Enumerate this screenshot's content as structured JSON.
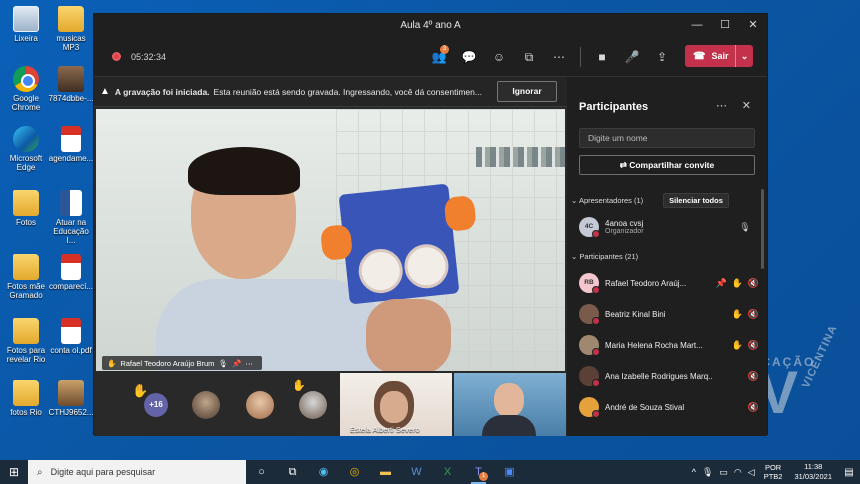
{
  "desktop": {
    "icons": [
      {
        "label": "Lixeira",
        "kind": "trash"
      },
      {
        "label": "musicas MP3",
        "kind": "folder"
      },
      {
        "label": "Google Chrome",
        "kind": "chrome"
      },
      {
        "label": "7874dbbe-...",
        "kind": "photo"
      },
      {
        "label": "Microsoft Edge",
        "kind": "edge"
      },
      {
        "label": "agendame...",
        "kind": "pdf"
      },
      {
        "label": "Fotos",
        "kind": "folder"
      },
      {
        "label": "Atuar na Educação I...",
        "kind": "word"
      },
      {
        "label": "Fotos mãe Gramado",
        "kind": "folder"
      },
      {
        "label": "comparecí...",
        "kind": "pdf"
      },
      {
        "label": "Fotos para revelar Rio",
        "kind": "folder"
      },
      {
        "label": "conta ol.pdf",
        "kind": "pdf"
      },
      {
        "label": "fotos Rio",
        "kind": "folder"
      },
      {
        "label": "CTHJ9652...",
        "kind": "photo2"
      }
    ]
  },
  "window": {
    "title": "Aula 4º ano A",
    "controls": {
      "minimize": "—",
      "maximize": "☐",
      "close": "✕"
    }
  },
  "toolbar": {
    "timer": "05:32:34",
    "participants_badge": "3",
    "leave_label": "Sair",
    "icons": [
      "people-icon",
      "chat-icon",
      "reactions-icon",
      "rooms-icon",
      "more-icon",
      "camera-icon",
      "mic-icon",
      "share-icon"
    ]
  },
  "banner": {
    "bold": "A gravação foi iniciada.",
    "text": "Esta reunião está sendo gravada. Ingressando, você dá consentimen...",
    "button": "Ignorar"
  },
  "main_video": {
    "name": "Rafael Teodoro Araújo Brum"
  },
  "strip": {
    "more_count": "+16",
    "thumbs": [
      {
        "name": "Estela Alberti Severo"
      }
    ]
  },
  "panel": {
    "title": "Participantes",
    "search_placeholder": "Digite um nome",
    "share_label": "Compartilhar convite",
    "presenters_label": "Apresentadores (1)",
    "mute_all": "Silenciar todos",
    "presenter": {
      "initials": "4C",
      "name": "4anoa cvsj",
      "role": "Organizador"
    },
    "participants_label": "Participantes (21)",
    "participants": [
      {
        "initials": "RB",
        "name": "Rafael Teodoro Araúj...",
        "hand": true,
        "pin": true,
        "color": "#f4c7cf"
      },
      {
        "initials": "",
        "name": "Beatriz Kinal Bini",
        "hand": true,
        "pin": false,
        "color": "#7a5a4a"
      },
      {
        "initials": "",
        "name": "Maria Helena Rocha Mart...",
        "hand": true,
        "pin": false,
        "color": "#a08870"
      },
      {
        "initials": "",
        "name": "Ana Izabelle Rodrigues Marq...",
        "hand": false,
        "pin": false,
        "color": "#5b4038"
      },
      {
        "initials": "",
        "name": "André de Souza Stival",
        "hand": false,
        "pin": false,
        "color": "#e5a23c"
      }
    ]
  },
  "watermark": {
    "line1": "EDUCAÇÃO",
    "letter": "V",
    "line2": "VICENTINA"
  },
  "taskbar": {
    "search_placeholder": "Digite aqui para pesquisar",
    "lang_top": "POR",
    "lang_bottom": "PTB2",
    "time": "11:38",
    "date": "31/03/2021",
    "teams_badge": "1"
  }
}
